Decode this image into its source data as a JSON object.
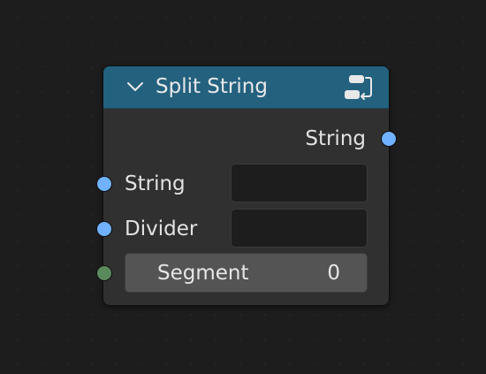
{
  "node": {
    "title": "Split String",
    "header_color": "#23617f",
    "collapse_icon": "chevron-down-icon",
    "node_icon": "node-group-icon",
    "outputs": [
      {
        "label": "String",
        "socket_type": "string",
        "socket_color": "#70b2ff"
      }
    ],
    "inputs": [
      {
        "label": "String",
        "value": "",
        "socket_type": "string",
        "socket_color": "#70b2ff"
      },
      {
        "label": "Divider",
        "value": "",
        "socket_type": "string",
        "socket_color": "#70b2ff"
      },
      {
        "label": "Segment",
        "value": "0",
        "socket_type": "integer",
        "socket_color": "#5a8a5c"
      }
    ]
  }
}
